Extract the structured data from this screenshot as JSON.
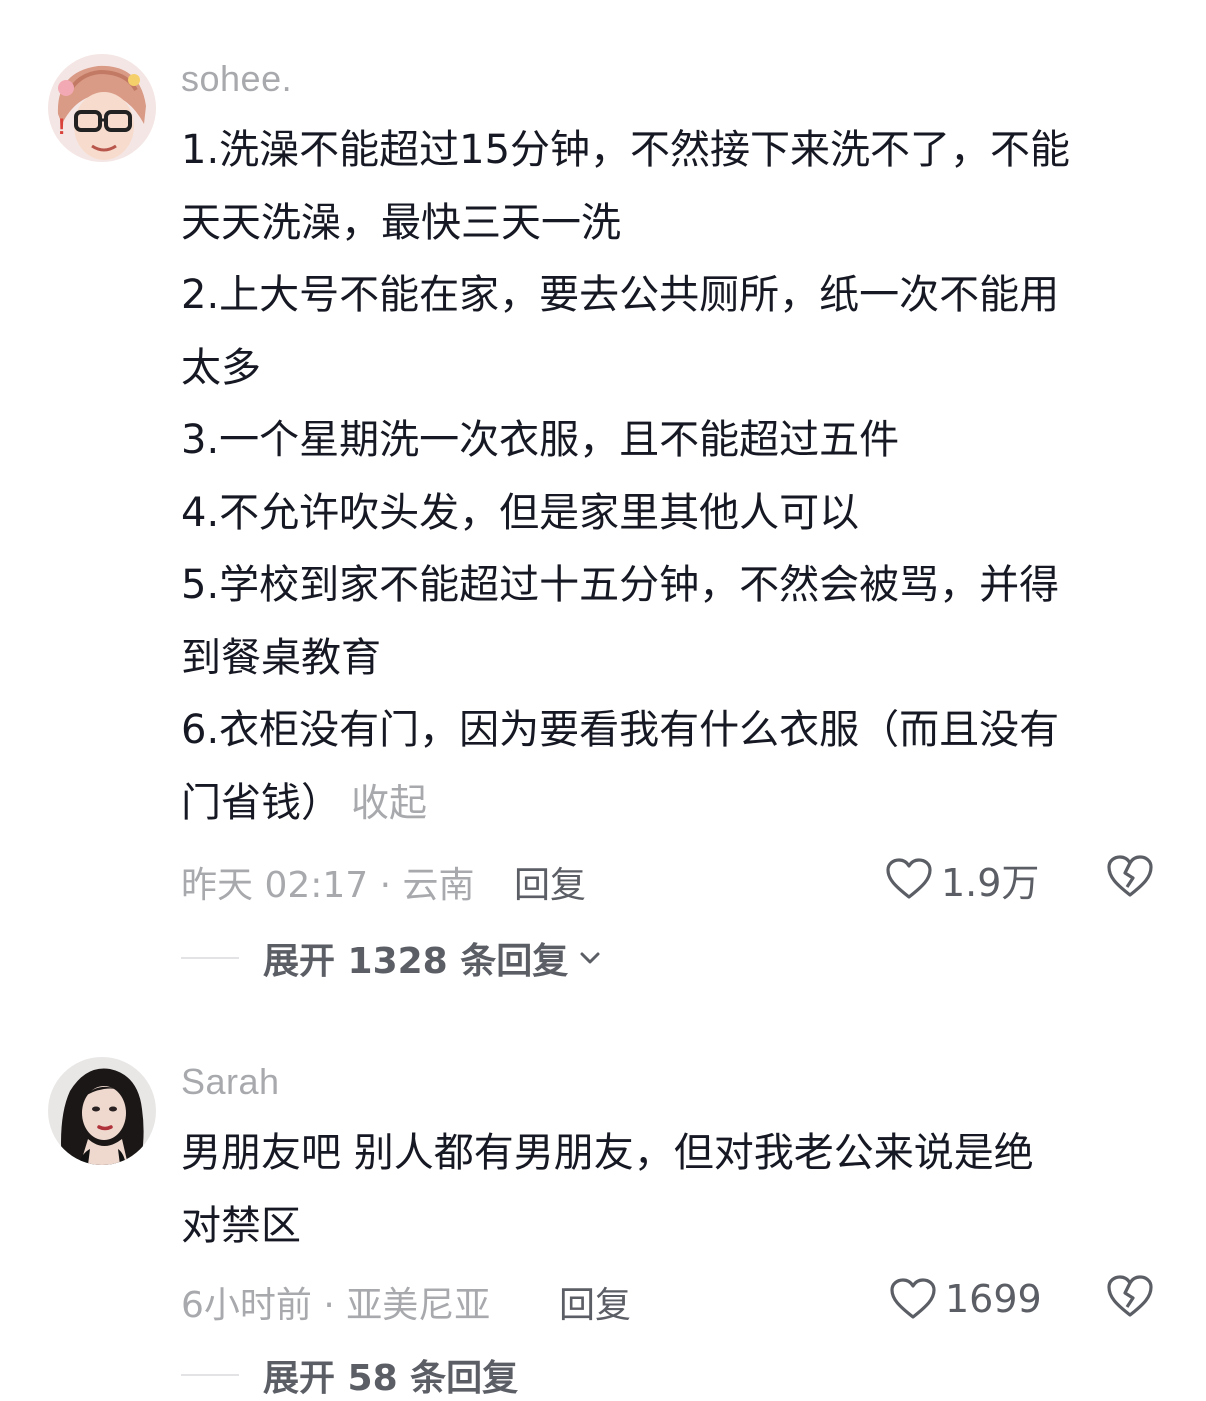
{
  "comments": [
    {
      "username": "sohee.",
      "avatar_icon": "avatar-cartoon-glasses",
      "lines": [
        "1.洗澡不能超过15分钟，不然接下来洗不了，不能",
        "天天洗澡，最快三天一洗",
        "2.上大号不能在家，要去公共厕所，纸一次不能用",
        "太多",
        "3.一个星期洗一次衣服，且不能超过五件",
        "4.不允许吹头发，但是家里其他人可以",
        "5.学校到家不能超过十五分钟，不然会被骂，并得",
        "到餐桌教育",
        "6.衣柜没有门，因为要看我有什么衣服（而且没有",
        "门省钱）"
      ],
      "collapse_label": "收起",
      "meta": "昨天 02:17 · 云南",
      "reply_label": "回复",
      "like_count": "1.9万",
      "expand_label": "展开 1328 条回复"
    },
    {
      "username": "Sarah",
      "avatar_icon": "avatar-dark-hair-woman",
      "lines": [
        "男朋友吧 别人都有男朋友，但对我老公来说是绝",
        "对禁区"
      ],
      "meta": "6小时前 · 亚美尼亚",
      "reply_label": "回复",
      "like_count": "1699",
      "expand_label": "展开 58 条回复"
    }
  ],
  "colors": {
    "text": "#161823",
    "secondary": "#a8a9ad",
    "action": "#5c5e66"
  }
}
